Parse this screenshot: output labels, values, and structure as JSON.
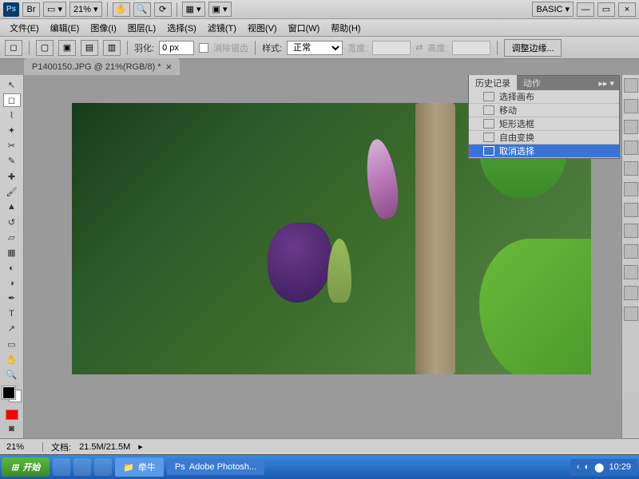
{
  "topbar": {
    "app_logo": "Ps",
    "bridge": "Br",
    "zoom_level": "21%",
    "workspace_label": "BASIC"
  },
  "menubar": {
    "items": [
      "文件(E)",
      "编辑(E)",
      "图像(I)",
      "图层(L)",
      "选择(S)",
      "滤镜(T)",
      "视图(V)",
      "窗口(W)",
      "帮助(H)"
    ]
  },
  "optbar": {
    "feather_label": "羽化:",
    "feather_value": "0 px",
    "antialias_label": "消除锯齿",
    "style_label": "样式:",
    "style_value": "正常",
    "width_label": "宽度:",
    "height_label": "高度:",
    "refine_btn": "调整边缘..."
  },
  "document": {
    "tab_title": "P1400150.JPG @ 21%(RGB/8) *"
  },
  "history_panel": {
    "tab_history": "历史记录",
    "tab_actions": "动作",
    "items": [
      "选择画布",
      "移动",
      "矩形选框",
      "自由变换",
      "取消选择"
    ]
  },
  "statusbar": {
    "zoom": "21%",
    "doc_size_label": "文档:",
    "doc_size": "21.5M/21.5M"
  },
  "taskbar": {
    "start": "开始",
    "item1": "牵牛",
    "item2": "Adobe Photosh...",
    "clock": "10:29"
  },
  "colors": {
    "foreground": "#000000",
    "background": "#ffffff",
    "extra_swatch": "#ff0000"
  }
}
